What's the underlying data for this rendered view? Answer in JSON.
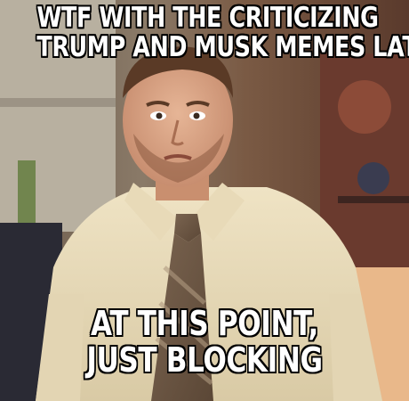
{
  "meme": {
    "top_text": [
      "WTF WITH THE CRITICIZING",
      "TRUMP AND MUSK MEMES LATELY"
    ],
    "bottom_text": [
      "AT THIS POINT,",
      "JUST BLOCKING"
    ]
  }
}
